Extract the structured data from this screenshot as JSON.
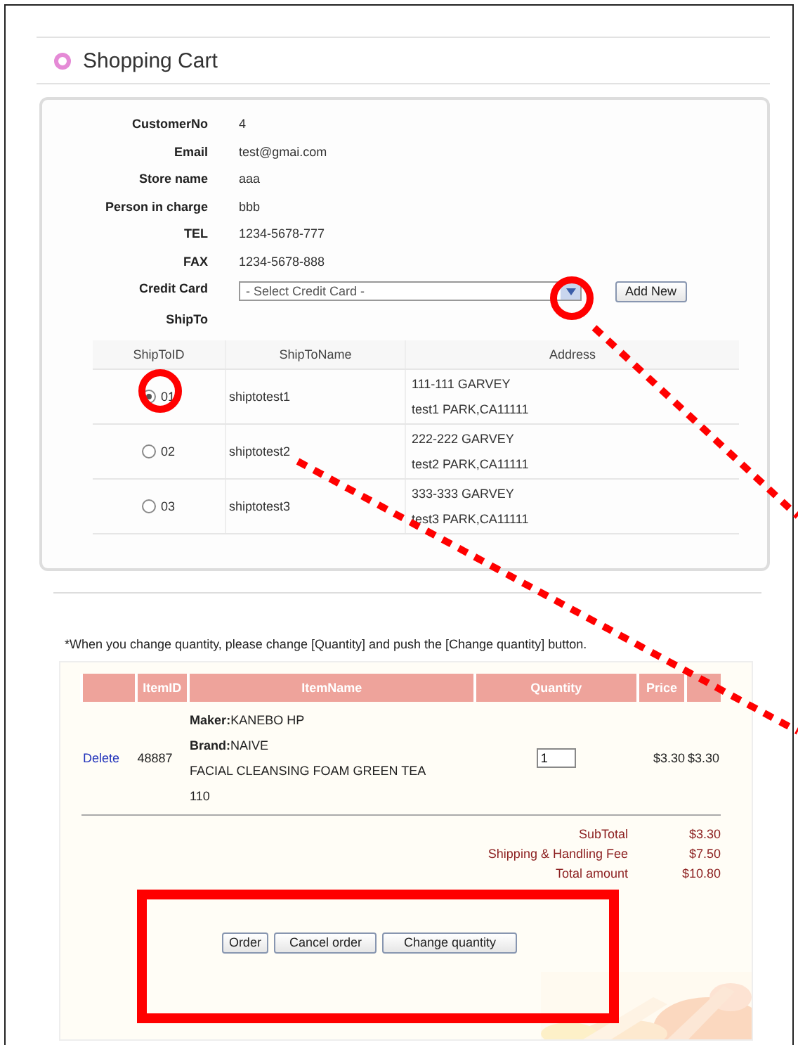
{
  "page": {
    "title": "Shopping Cart"
  },
  "customer": {
    "fields": [
      {
        "label": "CustomerNo",
        "value": "4"
      },
      {
        "label": "Email",
        "value": "test@gmai.com"
      },
      {
        "label": "Store name",
        "value": "aaa"
      },
      {
        "label": "Person in charge",
        "value": "bbb"
      },
      {
        "label": "TEL",
        "value": "1234-5678-777"
      },
      {
        "label": "FAX",
        "value": "1234-5678-888"
      }
    ]
  },
  "credit_card": {
    "label": "Credit Card",
    "select": "- Select Credit Card -",
    "button": "Add New"
  },
  "ship_to": {
    "label": "ShipTo",
    "columns": [
      "ShipToID",
      "ShipToName",
      "Address"
    ],
    "rows": [
      {
        "id": "01",
        "name": "shiptotest1",
        "address": [
          "111-111 GARVEY",
          "test1 PARK,CA11111"
        ],
        "selected": true
      },
      {
        "id": "02",
        "name": "shiptotest2",
        "address": [
          "222-222 GARVEY",
          "test2 PARK,CA11111"
        ],
        "selected": false
      },
      {
        "id": "03",
        "name": "shiptotest3",
        "address": [
          "333-333 GARVEY",
          "test3 PARK,CA11111"
        ],
        "selected": false
      }
    ]
  },
  "note": "*When you change quantity, please change [Quantity] and push the [Change quantity] button.",
  "cart": {
    "columns": [
      "ItemID",
      "ItemName",
      "Quantity",
      "Price"
    ],
    "items": [
      {
        "action": "Delete",
        "item_id": "48887",
        "maker": "**Maker:**KANEBO HP",
        "brand": "**Brand:**NAIVE",
        "name": "FACIAL CLEANSING FOAM GREEN TEA 110",
        "quantity": "1",
        "price": "$3.30",
        "sum": "$3.30"
      }
    ],
    "totals": [
      {
        "label": "SubTotal",
        "value": "$3.30"
      },
      {
        "label": "Shipping & Handling Fee",
        "value": "$7.50"
      },
      {
        "label": "Total amount",
        "value": "$10.80"
      }
    ],
    "buttons": [
      "Order",
      "Cancel order",
      "Change quantity"
    ]
  }
}
